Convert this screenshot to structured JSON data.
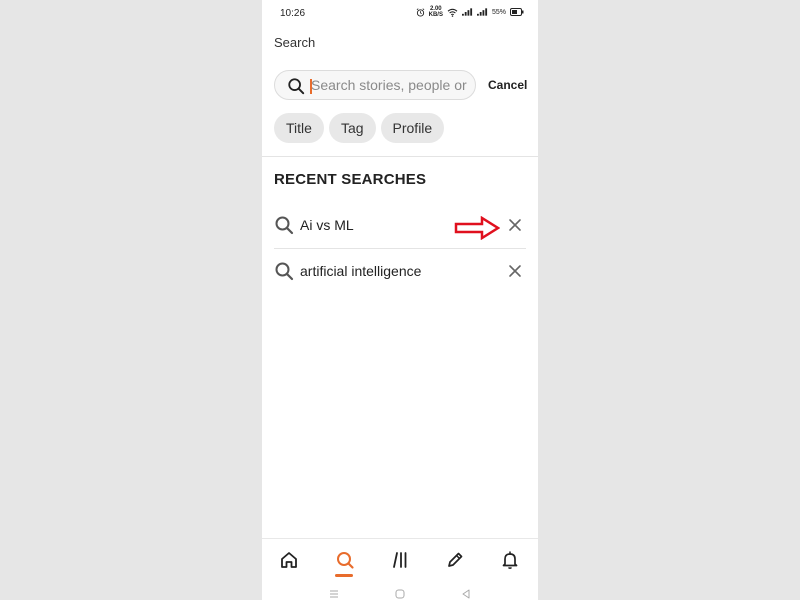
{
  "status_bar": {
    "time": "10:26",
    "speed_value": "2.00",
    "speed_unit": "KB/S",
    "battery": "55%"
  },
  "header": {
    "title": "Search"
  },
  "search": {
    "placeholder": "Search stories, people or r...",
    "value": "",
    "cancel_label": "Cancel"
  },
  "filters": [
    {
      "label": "Title"
    },
    {
      "label": "Tag"
    },
    {
      "label": "Profile"
    }
  ],
  "recent": {
    "title": "RECENT SEARCHES",
    "items": [
      {
        "label": "Ai vs ML"
      },
      {
        "label": "artificial intelligence"
      }
    ]
  },
  "bottom_nav": {
    "items": [
      "home-icon",
      "search-icon",
      "library-icon",
      "write-icon",
      "notifications-icon"
    ],
    "active": "search-icon"
  },
  "colors": {
    "accent": "#e86c2c",
    "annotation_arrow": "#e0101e"
  }
}
